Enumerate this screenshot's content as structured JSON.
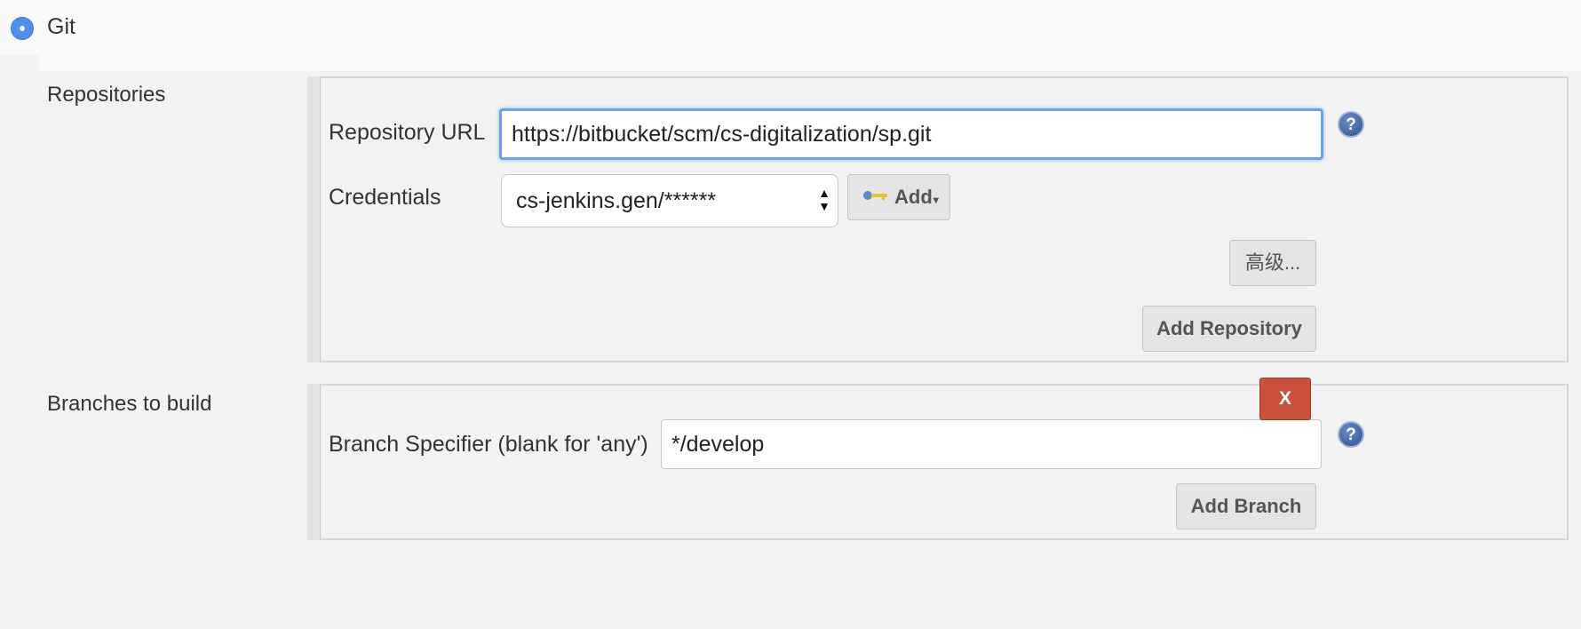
{
  "scm": {
    "option_label": "Git",
    "selected": true
  },
  "repositories": {
    "section_label": "Repositories",
    "url_label": "Repository URL",
    "url_value": "https://bitbucket/scm/cs-digitalization/sp.git",
    "credentials_label": "Credentials",
    "credentials_value": "cs-jenkins.gen/******",
    "add_label": "Add",
    "advanced_label": "高级...",
    "add_repository_label": "Add Repository"
  },
  "branches": {
    "section_label": "Branches to build",
    "delete_label": "X",
    "specifier_label": "Branch Specifier (blank for 'any')",
    "specifier_value": "*/develop",
    "add_branch_label": "Add Branch"
  },
  "icons": {
    "help": "help-icon",
    "key": "key-icon",
    "dropdown": "dropdown-arrow-icon"
  },
  "colors": {
    "radio": "#4f8fea",
    "focus_border": "#6aa0ee",
    "delete_button": "#c9503c",
    "help_icon": "#2b4f8f"
  }
}
